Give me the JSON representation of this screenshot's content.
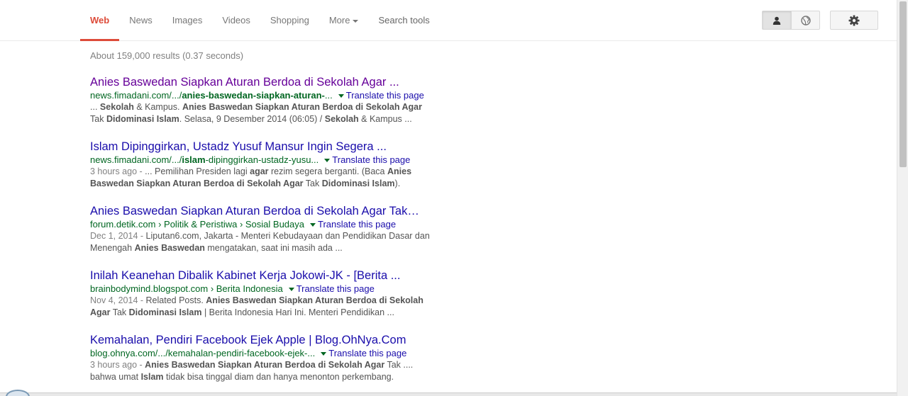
{
  "nav": {
    "tabs": [
      {
        "label": "Web"
      },
      {
        "label": "News"
      },
      {
        "label": "Images"
      },
      {
        "label": "Videos"
      },
      {
        "label": "Shopping"
      },
      {
        "label": "More"
      },
      {
        "label": "Search tools"
      }
    ],
    "active_color": "#dd4b39",
    "icons": {
      "personal": "person-icon",
      "global": "globe-icon",
      "settings": "gear-icon"
    }
  },
  "stats": "About 159,000 results (0.37 seconds)",
  "translate_label": "Translate this page",
  "results": [
    {
      "title": "Anies Baswedan Siapkan Aturan Berdoa di Sekolah Agar ...",
      "visited": true,
      "cite_pre": "news.fimadani.com/.../",
      "cite_bold": "anies-baswedan-siapkan-aturan-",
      "cite_post": "...",
      "snip_date": "",
      "snip_l1": "... <b>Sekolah</b> &amp; Kampus. <b>Anies Baswedan Siapkan Aturan Berdoa di Sekolah Agar</b>",
      "snip_l2": "Tak <b>Didominasi Islam</b>. Selasa, 9 Desember 2014 (06:05) / <b>Sekolah</b> &amp; Kampus ..."
    },
    {
      "title": "Islam Dipinggirkan, Ustadz Yusuf Mansur Ingin Segera ...",
      "visited": false,
      "cite_pre": "news.fimadani.com/.../",
      "cite_bold": "islam",
      "cite_post": "-dipinggirkan-ustadz-yusu...",
      "snip_date": "3 hours ago - ",
      "snip_l1": "... Pemilihan Presiden lagi <b>agar</b> rezim segera berganti. (Baca <b>Anies</b>",
      "snip_l2": "<b>Baswedan Siapkan Aturan Berdoa di Sekolah Agar</b> Tak <b>Didominasi Islam</b>)."
    },
    {
      "title": "Anies Baswedan Siapkan Aturan Berdoa di Sekolah Agar Tak…",
      "visited": false,
      "cite_pre": "forum.detik.com › Politik &amp; Peristiwa › Sosial Budaya",
      "cite_bold": "",
      "cite_post": "",
      "snip_date": "Dec 1, 2014 - ",
      "snip_l1": "Liputan6.com, Jakarta - Menteri Kebudayaan dan Pendidikan Dasar dan",
      "snip_l2": "Menengah <b>Anies Baswedan</b> mengatakan, saat ini masih ada ..."
    },
    {
      "title": "Inilah Keanehan Dibalik Kabinet Kerja Jokowi-JK - [Berita ...",
      "visited": false,
      "cite_pre": "brainbodymind.blogspot.com › Berita Indonesia",
      "cite_bold": "",
      "cite_post": "",
      "snip_date": "Nov 4, 2014 - ",
      "snip_l1": "Related Posts. <b>Anies Baswedan Siapkan Aturan Berdoa di Sekolah</b>",
      "snip_l2": "<b>Agar</b> Tak <b>Didominasi Islam</b> | Berita Indonesia Hari Ini. Menteri Pendidikan ..."
    },
    {
      "title": "Kemahalan, Pendiri Facebook Ejek Apple | Blog.OhNya.Com",
      "visited": false,
      "cite_pre": "blog.ohnya.com/.../kemahalan-pendiri-facebook-ejek-...",
      "cite_bold": "",
      "cite_post": "",
      "snip_date": "3 hours ago - ",
      "snip_l1": "<b>Anies Baswedan Siapkan Aturan Berdoa di Sekolah Agar</b> Tak ....",
      "snip_l2": "bahwa umat <b>Islam</b> tidak bisa tinggal diam dan hanya menonton perkembang."
    }
  ]
}
